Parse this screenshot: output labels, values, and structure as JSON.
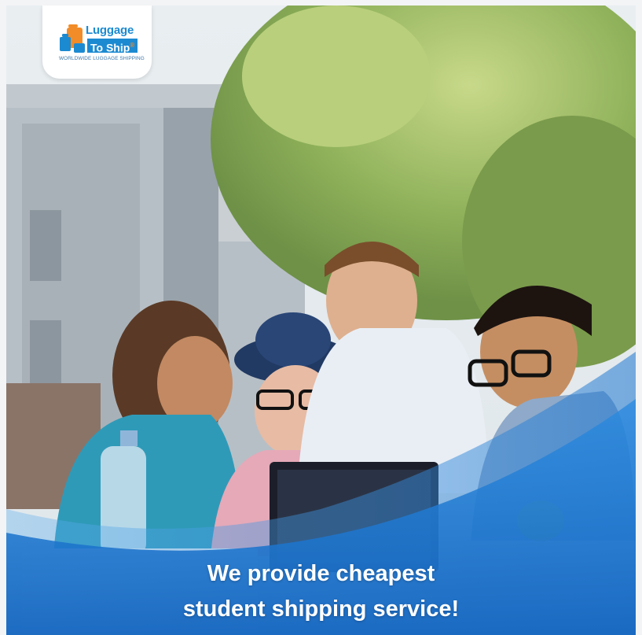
{
  "logo": {
    "brand_line1": "Luggage",
    "brand_line2": "To Ship",
    "registered": "®",
    "tagline": "WORLDWIDE LUGGAGE SHIPPING"
  },
  "banner": {
    "headline_line1": "We provide cheapest",
    "headline_line2": "student shipping service!"
  },
  "colors": {
    "brand_blue": "#1c8ad1",
    "brand_orange": "#f28c28",
    "wave_blue": "#1f7fd4"
  }
}
